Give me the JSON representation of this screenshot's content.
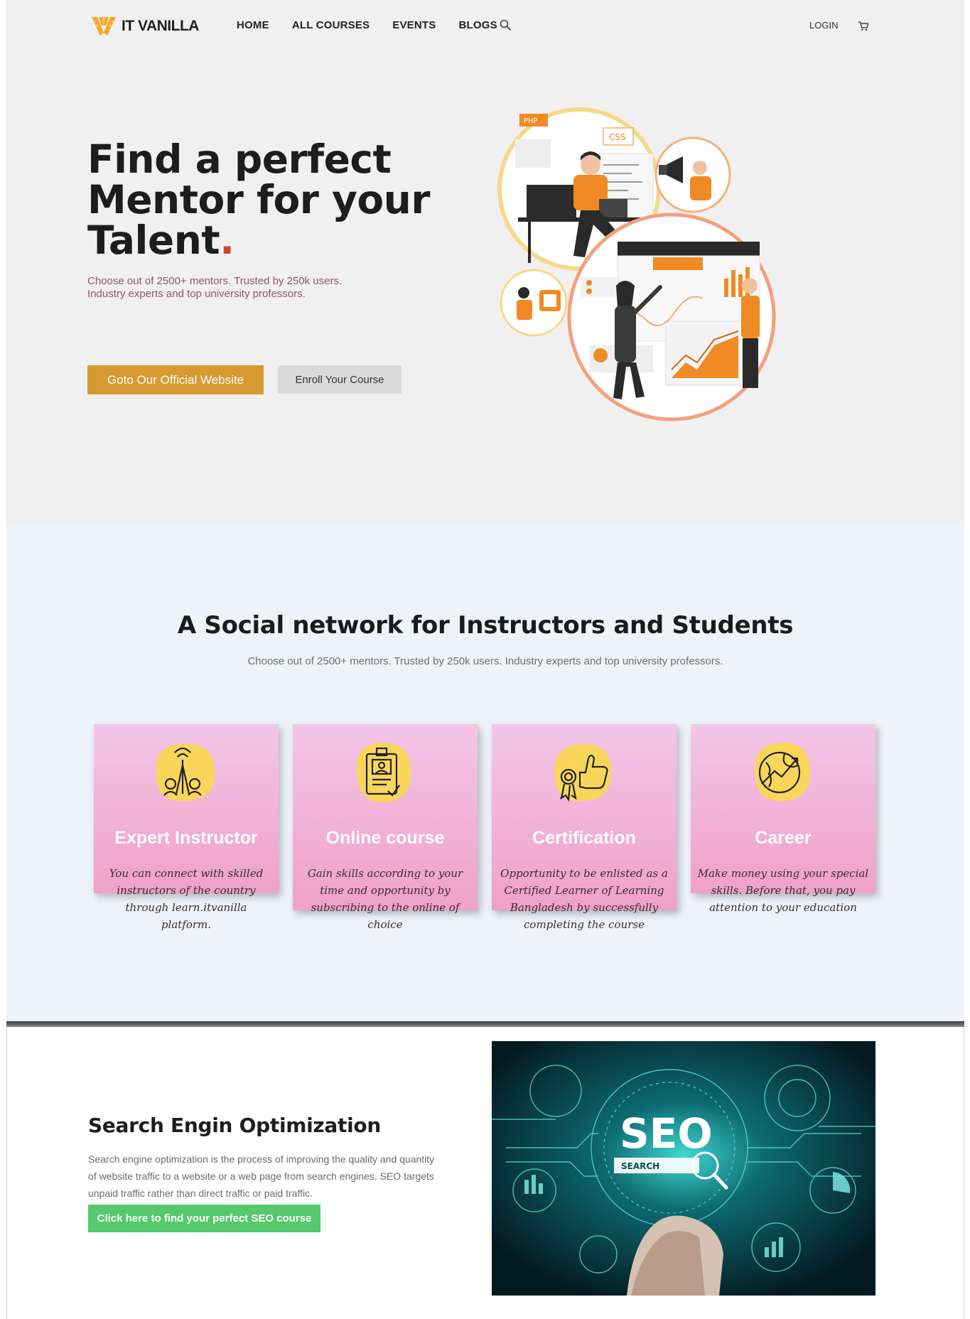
{
  "brand": {
    "name": "IT VANILLA",
    "accent": "#d79a31",
    "brand_orange": "#f5a623"
  },
  "nav": {
    "links": [
      "HOME",
      "ALL COURSES",
      "EVENTS",
      "BLOGS"
    ],
    "search_icon": "search-icon",
    "login": "LOGIN",
    "cart_icon": "cart-icon"
  },
  "hero": {
    "title_line1": "Find a perfect",
    "title_line2": "Mentor for your",
    "title_line3": "Talent",
    "title_dot": ".",
    "subtitle_line1": "Choose out of 2500+ mentors. Trusted by 250k users.",
    "subtitle_line2": "Industry experts and top university professors.",
    "primary_button": "Goto Our Official Website",
    "secondary_button": "Enroll Your Course",
    "illustration_labels": {
      "php": "PHP",
      "css": "CSS"
    }
  },
  "social": {
    "title": "A Social network for Instructors and Students",
    "subtitle": "Choose out of 2500+ mentors. Trusted by 250k users. Industry experts and top university professors.",
    "cards": [
      {
        "title": "Expert Instructor",
        "text": "You can connect with skilled instructors of the country through learn.itvanilla platform.",
        "icon": "network-people-icon"
      },
      {
        "title": "Online course",
        "text": "Gain skills according to your time and opportunity by subscribing to the online of choice",
        "icon": "id-card-icon"
      },
      {
        "title": "Certification",
        "text": "Opportunity to be enlisted as a Certified Learner of Learning Bangladesh by successfully completing the course",
        "icon": "badge-thumbs-up-icon"
      },
      {
        "title": "Career",
        "text": "Make money using your special skills. Before that, you pay attention to your education",
        "icon": "globe-growth-icon"
      }
    ]
  },
  "seo": {
    "title": "Search Engin Optimization",
    "text": "Search engine optimization is the process of improving the quality and quantity of website traffic to a website or a web page from search engines. SEO targets unpaid traffic rather than direct traffic or paid traffic.",
    "button": "Click here to find your perfect SEO course",
    "image_title": "SEO",
    "image_label": "SEARCH"
  }
}
